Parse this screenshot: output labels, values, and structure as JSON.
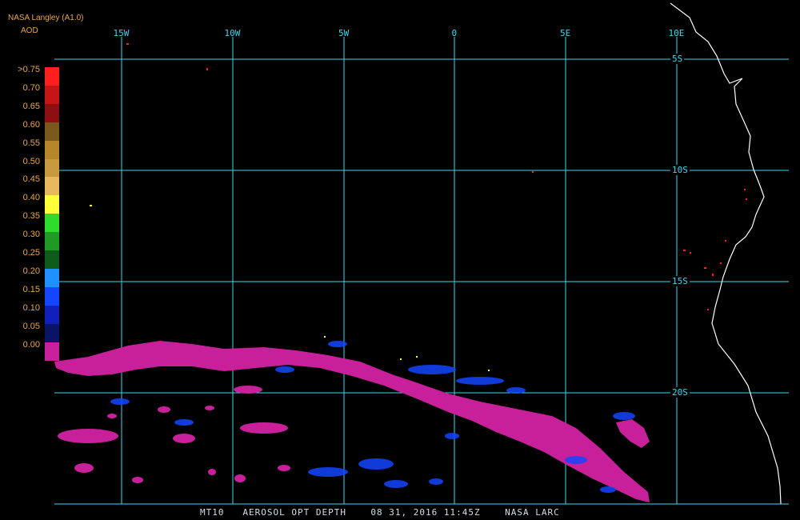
{
  "header": {
    "title": "NASA Langley (A1.0)",
    "units": "AOD"
  },
  "legend": {
    "levels": [
      {
        "label": ">0.75",
        "color": "#ff1f1f"
      },
      {
        "label": "0.70",
        "color": "#c41616"
      },
      {
        "label": "0.65",
        "color": "#8e0f12"
      },
      {
        "label": "0.60",
        "color": "#7a5a1c"
      },
      {
        "label": "0.55",
        "color": "#b8862a"
      },
      {
        "label": "0.50",
        "color": "#c89a40"
      },
      {
        "label": "0.45",
        "color": "#e8b860"
      },
      {
        "label": "0.40",
        "color": "#ffff3a"
      },
      {
        "label": "0.35",
        "color": "#2edc2e"
      },
      {
        "label": "0.30",
        "color": "#1f9a25"
      },
      {
        "label": "0.25",
        "color": "#0e5a18"
      },
      {
        "label": "0.20",
        "color": "#1e90ff"
      },
      {
        "label": "0.15",
        "color": "#1446ff"
      },
      {
        "label": "0.10",
        "color": "#1020b8"
      },
      {
        "label": "0.05",
        "color": "#0a1466"
      },
      {
        "label": "0.00",
        "color": "#c8209a"
      }
    ]
  },
  "grid": {
    "longitudes": [
      "15W",
      "10W",
      "5W",
      "0",
      "5E",
      "10E"
    ],
    "latitudes": [
      "5S",
      "10S",
      "15S",
      "20S"
    ],
    "line_color": "#42d6ee"
  },
  "colors": {
    "plume": "#c8209a",
    "coastline": "#ffffff",
    "background": "#000000",
    "blue_aerosol": "#1446ff",
    "red_pixels": "#ff2020"
  },
  "footer": "MT10   AEROSOL OPT DEPTH    08 31, 2016 11:45Z    NASA LARC"
}
